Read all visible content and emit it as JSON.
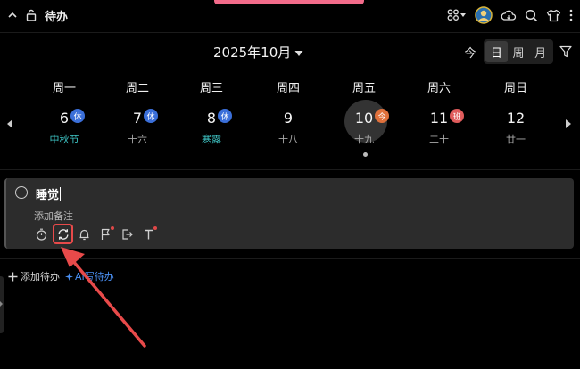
{
  "header": {
    "title": "待办",
    "icons": [
      "chevron-up-icon",
      "unlock-icon",
      "apps-grid-icon",
      "avatar",
      "cloud-sync-icon",
      "search-icon",
      "shirt-icon",
      "more-icon"
    ]
  },
  "calendar": {
    "month_label": "2025年10月",
    "today_button": "今",
    "view_tabs": [
      {
        "label": "日",
        "active": true
      },
      {
        "label": "周",
        "active": false
      },
      {
        "label": "月",
        "active": false
      }
    ],
    "days": [
      {
        "weekday": "周一",
        "date": "6",
        "badge": "休",
        "badge_type": "rest",
        "sub": "中秋节",
        "festival": true
      },
      {
        "weekday": "周二",
        "date": "7",
        "badge": "休",
        "badge_type": "rest",
        "sub": "十六",
        "festival": false
      },
      {
        "weekday": "周三",
        "date": "8",
        "badge": "休",
        "badge_type": "rest",
        "sub": "寒露",
        "festival": true
      },
      {
        "weekday": "周四",
        "date": "9",
        "badge": "",
        "badge_type": "",
        "sub": "十八",
        "festival": false
      },
      {
        "weekday": "周五",
        "date": "10",
        "badge": "今",
        "badge_type": "today",
        "sub": "十九",
        "festival": false
      },
      {
        "weekday": "周六",
        "date": "11",
        "badge": "班",
        "badge_type": "work",
        "sub": "二十",
        "festival": false
      },
      {
        "weekday": "周日",
        "date": "12",
        "badge": "",
        "badge_type": "",
        "sub": "廿一",
        "festival": false
      }
    ]
  },
  "task": {
    "title": "睡觉",
    "note_placeholder": "添加备注"
  },
  "footer": {
    "add_label": "添加待办",
    "ai_label": "AI写待办"
  },
  "colors": {
    "accent": "#4a8ff2",
    "rest_badge": "#3b6fd9",
    "work_badge": "#e05c5c",
    "today_badge": "#e0713c",
    "festival": "#3ec6c6",
    "annotation": "#e84a4a"
  }
}
